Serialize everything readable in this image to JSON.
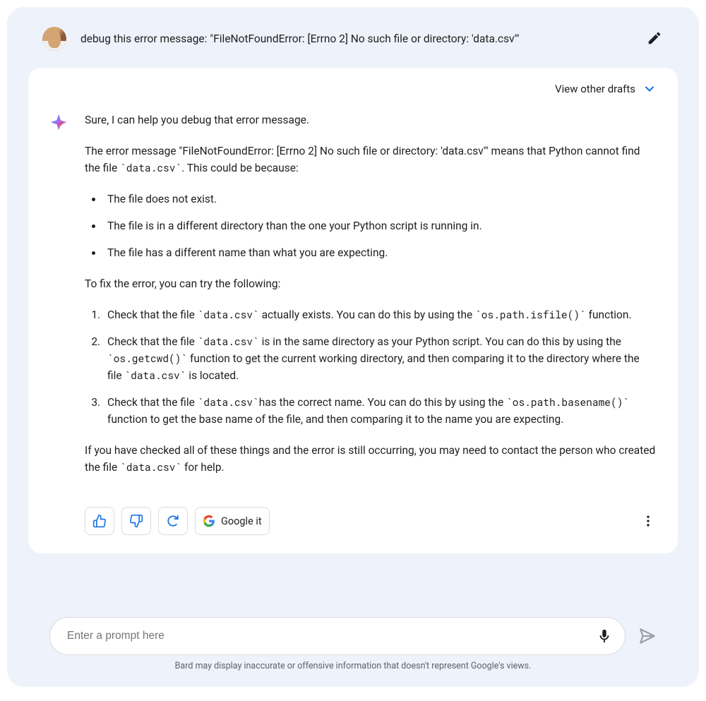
{
  "user_prompt": "debug this error message: \"FileNotFoundError: [Errno 2] No such file or directory: 'data.csv'\"",
  "drafts_label": "View other drafts",
  "response": {
    "intro": "Sure, I can help you debug that error message.",
    "explain_pre": "The error message \"FileNotFoundError: [Errno 2] No such file or directory: 'data.csv'\" means that Python cannot find the file ",
    "explain_code": "`data.csv`",
    "explain_post": ". This could be because:",
    "cause_1": "The file does not exist.",
    "cause_2": "The file is in a different directory than the one your Python script is running in.",
    "cause_3": "The file has a different name than what you are expecting.",
    "fix_intro": "To fix the error, you can try the following:",
    "fix1_a": "Check that the file ",
    "fix1_code1": "`data.csv`",
    "fix1_b": " actually exists. You can do this by using the ",
    "fix1_code2": "`os.path.isfile()`",
    "fix1_c": " function.",
    "fix2_a": "Check that the file ",
    "fix2_code1": "`data.csv`",
    "fix2_b": " is in the same directory as your Python script. You can do this by using the ",
    "fix2_code2": "`os.getcwd()`",
    "fix2_c": " function to get the current working directory, and then comparing it to the directory where the file ",
    "fix2_code3": "`data.csv`",
    "fix2_d": " is located.",
    "fix3_a": "Check that the file ",
    "fix3_code1": "`data.csv`",
    "fix3_b": "has the correct name. You can do this by using the ",
    "fix3_code2": "`os.path.basename()`",
    "fix3_c": " function to get the base name of the file, and then comparing it to the name you are expecting.",
    "closing_a": "If you have checked all of these things and the error is still occurring, you may need to contact the person who created the file ",
    "closing_code": "`data.csv`",
    "closing_b": " for help."
  },
  "actions": {
    "google_it": "Google it"
  },
  "input": {
    "placeholder": "Enter a prompt here"
  },
  "disclaimer": "Bard may display inaccurate or offensive information that doesn't represent Google's views."
}
